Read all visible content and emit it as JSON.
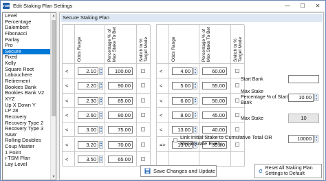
{
  "window": {
    "app_icon": "TSM",
    "title": "Edit Staking Plan Settings",
    "controls": {
      "minimize": "—",
      "maximize": "☐",
      "close": "✕"
    }
  },
  "plans": [
    "Level",
    "Percentage",
    "Dalembert",
    "Fibonacci",
    "Parlay",
    "Pro",
    "Secure",
    "Fixed",
    "Kelly",
    "Square Root",
    "Labouchere",
    "Retirement",
    "Bookies Bank",
    "Bookies Bank V2",
    "XYZ",
    "Up X Down Y",
    "LP 28",
    "Recovery",
    "Recovery Type 2",
    "Recovery Type 3",
    "SAW",
    "Rolling Doubles",
    "Coup Master",
    "1 Point",
    "i-TSM Plan",
    "Lay Level"
  ],
  "selected_plan": "Secure",
  "panel": {
    "title": "Secure Staking Plan"
  },
  "headers": {
    "odds_range": "Odds Range",
    "percentage": "Percentage % of Max Stake To Bet",
    "switch": "Switch to % Target Mode"
  },
  "left_table": [
    {
      "cmp": "<",
      "odds": "2.10",
      "pct": "100.00"
    },
    {
      "cmp": "<",
      "odds": "2.20",
      "pct": "90.00"
    },
    {
      "cmp": "<",
      "odds": "2.30",
      "pct": "85.00"
    },
    {
      "cmp": "<",
      "odds": "2.60",
      "pct": "80.00"
    },
    {
      "cmp": "<",
      "odds": "3.00",
      "pct": "75.00"
    },
    {
      "cmp": "<",
      "odds": "3.20",
      "pct": "70.00"
    },
    {
      "cmp": "<",
      "odds": "3.50",
      "pct": "65.00"
    }
  ],
  "right_table": [
    {
      "cmp": "<",
      "odds": "4.00",
      "pct": "60.00"
    },
    {
      "cmp": "<",
      "odds": "5.00",
      "pct": "55.00"
    },
    {
      "cmp": "<",
      "odds": "6.00",
      "pct": "50.00"
    },
    {
      "cmp": "<",
      "odds": "8.00",
      "pct": "45.00"
    },
    {
      "cmp": "<",
      "odds": "13.00",
      "pct": "40.00"
    },
    {
      "cmp": "=>",
      "odds": "13.00",
      "pct": "35.00"
    }
  ],
  "start_bank": {
    "label": "Start Bank",
    "value": ""
  },
  "max_stake_pct": {
    "label": "Max Stake Percentage % of Start Bank",
    "value": "10.00"
  },
  "max_stake": {
    "label": "Max Stake",
    "value": "10"
  },
  "link": {
    "label": "Link Initial Stake to Cumulative Total OR Recalculate Every",
    "value": "10000"
  },
  "buttons": {
    "save": "Save Changes and Update",
    "reset": "Reset All Staking Plan Settings to Default"
  },
  "colors": {
    "accent": "#0078d7",
    "header_bg": "#dde8f4"
  }
}
